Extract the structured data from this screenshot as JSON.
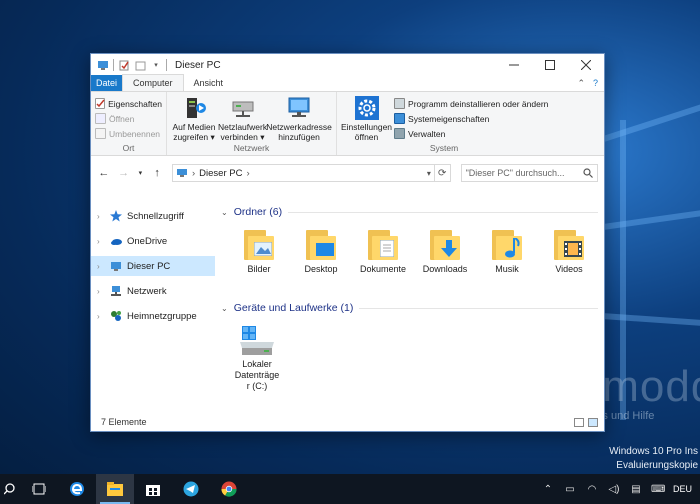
{
  "window": {
    "title": "Dieser PC",
    "tabs": {
      "file": "Datei",
      "computer": "Computer",
      "view": "Ansicht"
    }
  },
  "ribbon": {
    "location": {
      "label": "Ort",
      "properties": "Eigenschaften",
      "open": "Öffnen",
      "rename": "Umbenennen"
    },
    "network": {
      "label": "Netzwerk",
      "access_media_1": "Auf Medien",
      "access_media_2": "zugreifen",
      "map_drive_1": "Netzlaufwerk",
      "map_drive_2": "verbinden",
      "add_location_1": "Netzwerkadresse",
      "add_location_2": "hinzufügen"
    },
    "system": {
      "label": "System",
      "settings_1": "Einstellungen",
      "settings_2": "öffnen",
      "uninstall": "Programm deinstallieren oder ändern",
      "properties": "Systemeigenschaften",
      "manage": "Verwalten"
    }
  },
  "address": {
    "path": "Dieser PC",
    "search_placeholder": "\"Dieser PC\" durchsuch..."
  },
  "nav": {
    "items": [
      {
        "label": "Schnellzugriff",
        "icon": "star-icon"
      },
      {
        "label": "OneDrive",
        "icon": "cloud-icon"
      },
      {
        "label": "Dieser PC",
        "icon": "computer-icon"
      },
      {
        "label": "Netzwerk",
        "icon": "network-icon"
      },
      {
        "label": "Heimnetzgruppe",
        "icon": "homegroup-icon"
      }
    ]
  },
  "main": {
    "folders_header": "Ordner (6)",
    "folders": [
      "Bilder",
      "Desktop",
      "Dokumente",
      "Downloads",
      "Musik",
      "Videos"
    ],
    "drives_header": "Geräte und Laufwerke (1)",
    "drive_line1": "Lokaler",
    "drive_line2": "Datenträge",
    "drive_line3": "r (C:)",
    "status": "7 Elemente"
  },
  "desktop": {
    "watermark": "Deskmodder.d",
    "watermark_sub": "News, Tipps und Hilfe",
    "build_line1": "Windows 10 Pro Ins",
    "build_line2": "Evaluierungskopie"
  },
  "taskbar": {
    "language": "DEU"
  },
  "colors": {
    "accent": "#1979ca",
    "folder": "#ffd76a",
    "selection": "#cce8ff",
    "taskbar": "#0e1621"
  }
}
